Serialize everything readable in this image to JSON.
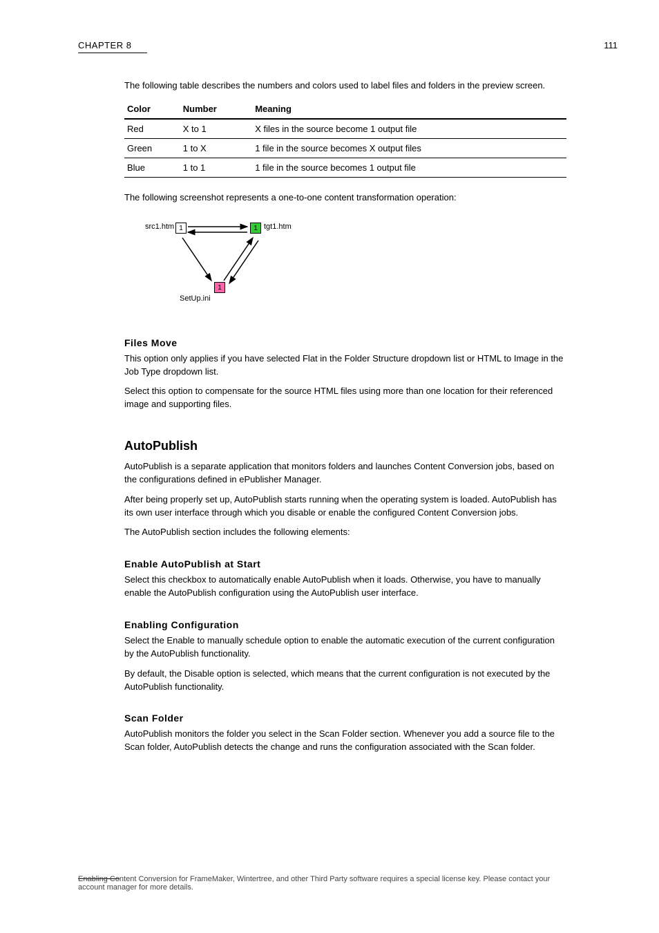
{
  "header": {
    "label": "CHAPTER 8",
    "page_number": "111"
  },
  "intro_para": "The following table describes the numbers and colors used to label files and folders in the preview screen.",
  "table": {
    "headers": [
      "Color",
      "Number",
      "Meaning"
    ],
    "rows": [
      [
        "Red",
        "X to 1",
        "X files in the source become 1 output file"
      ],
      [
        "Green",
        "1 to X",
        "1 file in the source becomes X output files"
      ],
      [
        "Blue",
        "1 to 1",
        "1 file in the source becomes 1 output file"
      ]
    ]
  },
  "example_intro": "The following screenshot represents a one-to-one content transformation operation:",
  "diagram": {
    "src_label": "src1.htm",
    "tgt_label": "tgt1.htm",
    "setup_label": "SetUp.ini",
    "node_text": "1"
  },
  "sections": {
    "filesmove": {
      "title": "Files Move",
      "p1": "This option only applies if you have selected Flat in the Folder Structure dropdown list or HTML to Image in the Job Type dropdown list.",
      "p2": "Select this option to compensate for the source HTML files using more than one location for their referenced image and supporting files."
    },
    "autopublish": {
      "title": "AutoPublish",
      "p1": "AutoPublish is a separate application that monitors folders and launches Content Conversion jobs, based on the configurations defined in ePublisher Manager.",
      "p2": "After being properly set up, AutoPublish starts running when the operating system is loaded. AutoPublish has its own user interface through which you disable or enable the configured Content Conversion jobs.",
      "p3": "The AutoPublish section includes the following elements:"
    },
    "enable_at_start": {
      "title": "Enable AutoPublish at Start",
      "p1": "Select this checkbox to automatically enable AutoPublish when it loads. Otherwise, you have to manually enable the AutoPublish configuration using the AutoPublish user interface."
    },
    "enabling_config": {
      "title": "Enabling Configuration",
      "p1": "Select the Enable to manually schedule option to enable the automatic execution of the current configuration by the AutoPublish functionality.",
      "p2": "By default, the Disable option is selected, which means that the current configuration is not executed by the AutoPublish functionality."
    },
    "scan_folder": {
      "title": "Scan Folder",
      "p1": "AutoPublish monitors the folder you select in the Scan Folder section. Whenever you add a source file to the Scan folder, AutoPublish detects the change and runs the configuration associated with the Scan folder."
    }
  },
  "footer": "Enabling Content Conversion for FrameMaker, Wintertree, and other Third Party software requires a special license key. Please contact your account manager for more details."
}
